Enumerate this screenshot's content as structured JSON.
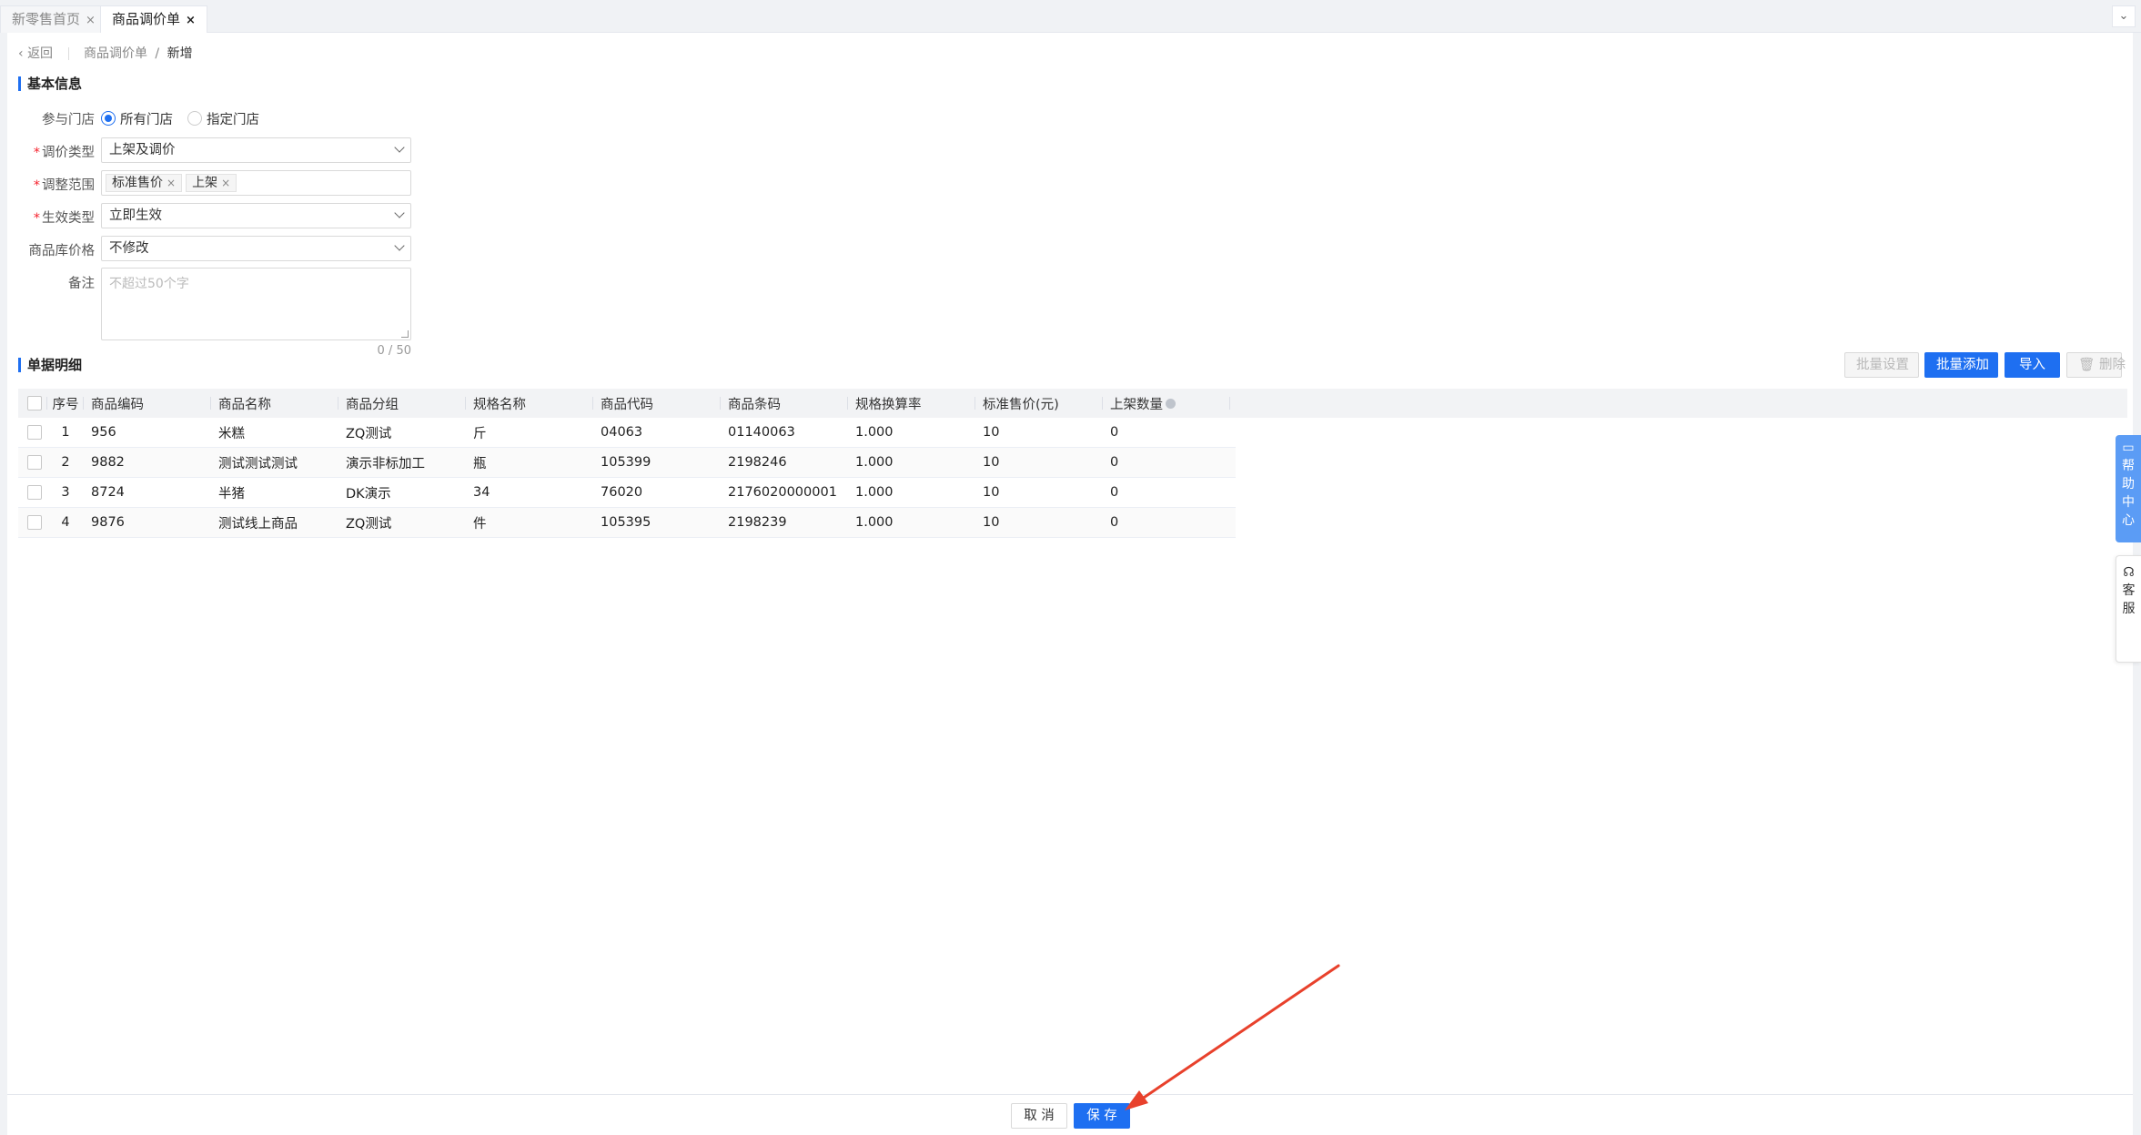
{
  "tabs": [
    {
      "label": "新零售首页",
      "close": "×"
    },
    {
      "label": "商品调价单",
      "close": "×"
    }
  ],
  "breadcrumb": {
    "back": "返回",
    "parent": "商品调价单",
    "separator": "/",
    "current": "新增"
  },
  "basic_info": {
    "title": "基本信息",
    "store_label": "参与门店",
    "store_options": [
      "所有门店",
      "指定门店"
    ],
    "store_selected": "所有门店",
    "price_type_label": "调价类型",
    "price_type_value": "上架及调价",
    "scope_label": "调整范围",
    "scope_tags": [
      "标准售价",
      "上架"
    ],
    "effect_type_label": "生效类型",
    "effect_type_value": "立即生效",
    "stock_price_label": "商品库价格",
    "stock_price_value": "不修改",
    "remark_label": "备注",
    "remark_placeholder": "不超过50个字",
    "remark_counter": "0 / 50"
  },
  "detail": {
    "title": "单据明细",
    "buttons": {
      "batch_set": "批量设置",
      "batch_add": "批量添加",
      "import": "导入",
      "delete": "删除"
    },
    "columns": [
      "序号",
      "商品编码",
      "商品名称",
      "商品分组",
      "规格名称",
      "商品代码",
      "商品条码",
      "规格换算率",
      "标准售价(元)",
      "上架数量"
    ],
    "rows": [
      [
        "1",
        "956",
        "米糕",
        "ZQ测试",
        "斤",
        "04063",
        "01140063",
        "1.000",
        "10",
        "0"
      ],
      [
        "2",
        "9882",
        "测试测试测试",
        "演示非标加工",
        "瓶",
        "105399",
        "2198246",
        "1.000",
        "10",
        "0"
      ],
      [
        "3",
        "8724",
        "半猪",
        "DK演示",
        "34",
        "76020",
        "2176020000001",
        "1.000",
        "10",
        "0"
      ],
      [
        "4",
        "9876",
        "测试线上商品",
        "ZQ测试",
        "件",
        "105395",
        "2198239",
        "1.000",
        "10",
        "0"
      ]
    ]
  },
  "float": {
    "help": [
      "帮",
      "助",
      "中",
      "心"
    ],
    "service": [
      "客",
      "服"
    ]
  },
  "footer": {
    "cancel": "取 消",
    "save": "保 存"
  },
  "colors": {
    "accent": "#1e6ff1",
    "annotation_arrow": "#e8412c"
  }
}
